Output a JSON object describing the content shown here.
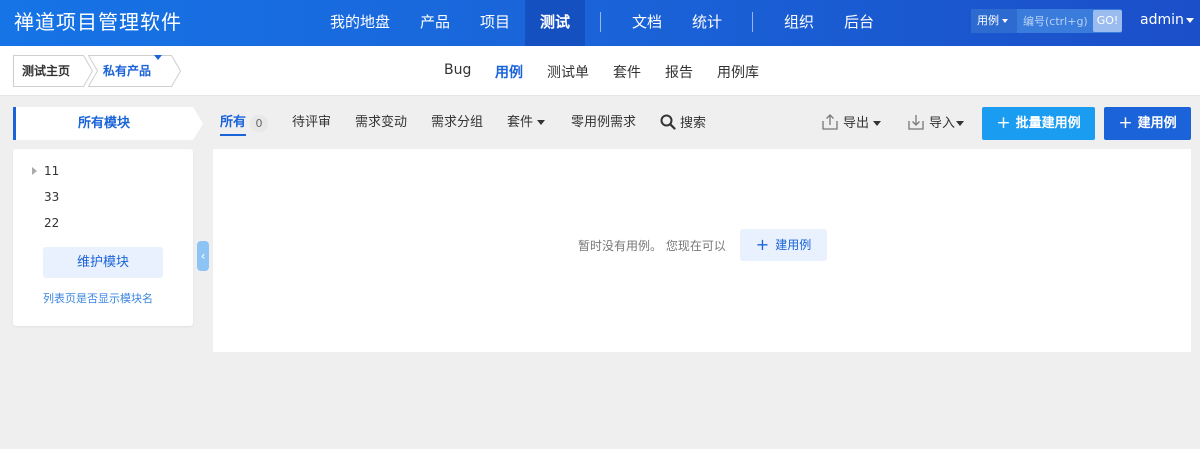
{
  "header": {
    "brand": "禅道项目管理软件",
    "nav": [
      {
        "label": "我的地盘"
      },
      {
        "label": "产品"
      },
      {
        "label": "项目"
      },
      {
        "label": "测试"
      },
      {
        "label": "文档"
      },
      {
        "label": "统计"
      },
      {
        "label": "组织"
      },
      {
        "label": "后台"
      }
    ],
    "active_nav": "测试",
    "search": {
      "type": "用例",
      "placeholder": "编号(ctrl+g)",
      "go": "GO!"
    },
    "user": "admin"
  },
  "subheader": {
    "breadcrumb": [
      {
        "label": "测试主页"
      },
      {
        "label": "私有产品"
      }
    ],
    "subnav": [
      {
        "label": "Bug"
      },
      {
        "label": "用例"
      },
      {
        "label": "测试单"
      },
      {
        "label": "套件"
      },
      {
        "label": "报告"
      },
      {
        "label": "用例库"
      }
    ],
    "active_subnav": "用例"
  },
  "toolbar": {
    "module_title": "所有模块",
    "tabs": {
      "all": "所有",
      "all_count": "0",
      "pending": "待评审",
      "changed": "需求变动",
      "grouped": "需求分组",
      "suite": "套件",
      "zero": "零用例需求",
      "search": "搜索"
    },
    "export": "导出",
    "import": "导入",
    "batch_create": "批量建用例",
    "create": "建用例"
  },
  "sidebar": {
    "tree": [
      {
        "label": "11"
      },
      {
        "label": "33"
      },
      {
        "label": "22"
      }
    ],
    "maintain": "维护模块",
    "show_module_name": "列表页是否显示模块名"
  },
  "main": {
    "empty_text": "暂时没有用例。 您现在可以",
    "empty_create": "建用例"
  },
  "colors": {
    "header_start": "#1674e6",
    "header_end": "#1b4fc9",
    "accent": "#1a63d8",
    "batch_button": "#1a9cf0",
    "create_button": "#1a63d8"
  }
}
